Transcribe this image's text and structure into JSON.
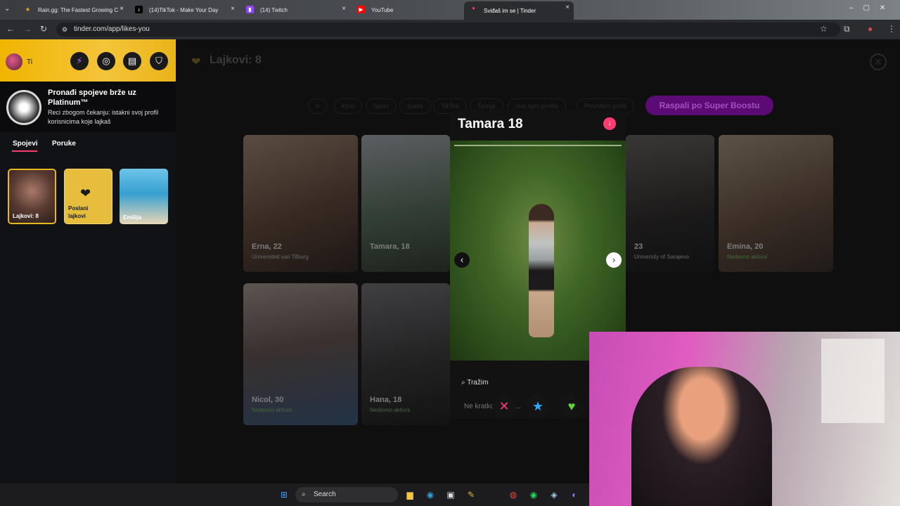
{
  "browser": {
    "tabs": [
      {
        "title": "Rain.gg: The Fastest Growing C",
        "icon": "star-icon"
      },
      {
        "title": "(14)TikTok - Make Your Day",
        "icon": "tiktok-icon"
      },
      {
        "title": "(14) Twitch",
        "icon": "twitch-icon"
      },
      {
        "title": "YouTube",
        "icon": "youtube-icon"
      },
      {
        "title": "Sviđaš im se | Tinder",
        "icon": "tinder-icon",
        "active": true
      }
    ],
    "url": "tinder.com/app/likes-you"
  },
  "sidebar": {
    "user_name": "Ti",
    "promo_title": "Pronađi spojeve brže uz Platinum™",
    "promo_subtitle": "Reci zbogom čekanju: istakni svoj profil korisnicima koje lajkaš",
    "tabs": [
      "Spojevi",
      "Poruke"
    ],
    "thumbs": [
      {
        "label": "Lajkovi: 8"
      },
      {
        "label": "Poslani lajkovi"
      },
      {
        "label": "Emilija"
      }
    ]
  },
  "main": {
    "title": "Lajkovi: 8",
    "filters": [
      "Kino",
      "Sport",
      "Sushi",
      "TikTok",
      "Šetnja",
      "Ima opis profila",
      "Potvrđeni profil"
    ],
    "boost_label": "Raspali po Super Boostu",
    "cards": [
      {
        "name": "Erna, 22",
        "sub": "Universiteit van Tilburg"
      },
      {
        "name": "Tamara, 18",
        "sub": ""
      },
      {
        "name": "23",
        "sub": "University of Sarajevo"
      },
      {
        "name": "Emina, 20",
        "sub": "Nedavno aktivni"
      },
      {
        "name": "Nicol, 30",
        "sub": "Nedavno aktivni"
      },
      {
        "name": "Hana, 18",
        "sub": "Nedavno aktivni"
      }
    ]
  },
  "profile": {
    "name": "Tamara 18",
    "search_label": "Tražim",
    "bio_teaser": "Ne kratko, može..."
  },
  "taskbar": {
    "search_label": "Search"
  }
}
